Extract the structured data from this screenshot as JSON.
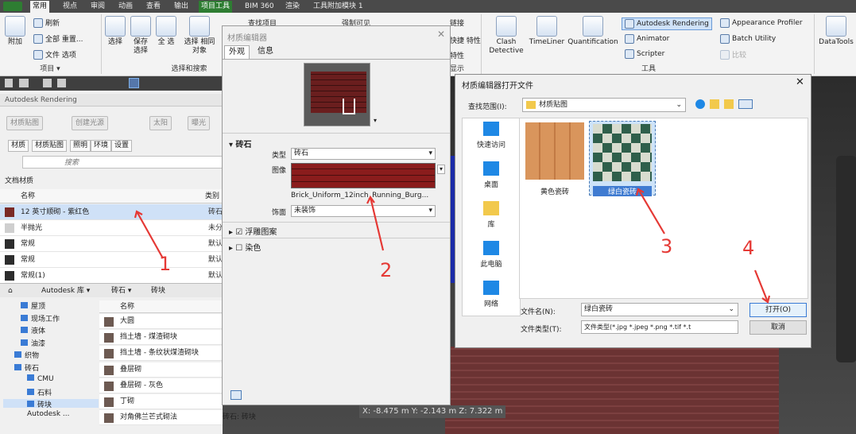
{
  "ribbon": {
    "tabs": [
      "常用",
      "视点",
      "审阅",
      "动画",
      "查看",
      "输出",
      "项目工具",
      "BIM 360",
      "渲染",
      "工具附加模块 1"
    ],
    "active_tab": "常用",
    "project_tab": "项目工具",
    "append": "附加",
    "refresh": "刷新",
    "reset_all": "全部 重置...",
    "file_options": "文件 选项",
    "select": "选择",
    "save_sel": "保存 选择",
    "select_all": "全 选",
    "select_same": "选择 相同对象",
    "group_project": "项目 ▾",
    "group_select": "选择和搜索",
    "find_items": "查找项目",
    "force_visible": "强制可见",
    "link": "链接",
    "quick_props": "快捷 特性",
    "props": "特性",
    "display": "显示",
    "clash": "Clash Detective",
    "timeliner": "TimeLiner",
    "quantification": "Quantification",
    "autodesk_rendering": "Autodesk Rendering",
    "appearance_profiler": "Appearance Profiler",
    "animator": "Animator",
    "batch_utility": "Batch Utility",
    "scripter": "Scripter",
    "compare": "比较",
    "group_tools": "工具",
    "datatools": "DataTools"
  },
  "rendering_panel": {
    "title": "Autodesk Rendering",
    "toolbar": [
      "材质贴图",
      "创建光源",
      "太阳",
      "曝光"
    ],
    "tabs": [
      "材质",
      "材质贴图",
      "照明",
      "环境",
      "设置"
    ],
    "search_placeholder": "搜索",
    "breadcrumb": "文档材质",
    "col_name": "名称",
    "col_type": "类别",
    "materials": [
      {
        "name": "12 英寸顺砌 - 紫红色",
        "type": "砖石",
        "swatch": "#7a2a26",
        "selected": true
      },
      {
        "name": "半抛光",
        "type": "未分",
        "swatch": "#cfcfcf"
      },
      {
        "name": "常规",
        "type": "默认",
        "swatch": "#2d2d2d"
      },
      {
        "name": "常规",
        "type": "默认",
        "swatch": "#2d2d2d"
      },
      {
        "name": "常规(1)",
        "type": "默认",
        "swatch": "#2d2d2d"
      }
    ],
    "lib_breadcrumb": [
      "Autodesk 库 ▾",
      "砖石 ▾",
      "砖块"
    ],
    "tree": [
      "屋顶",
      "现场工作",
      "液体",
      "油漆",
      "织物",
      "砖石",
      "CMU",
      "石料",
      "砖块"
    ],
    "lib_footer": "Autodesk ...",
    "lib_col_name": "名称",
    "lib_items": [
      {
        "name": "大圆",
        "type": ""
      },
      {
        "name": "挡土墙 - 煤渣砌块",
        "type": ""
      },
      {
        "name": "挡土墙 - 条纹状煤渣砌块",
        "type": ""
      },
      {
        "name": "叠层砌",
        "type": ""
      },
      {
        "name": "叠层砌 - 灰色",
        "type": ""
      },
      {
        "name": "丁砌",
        "type": ""
      },
      {
        "name": "对角佛兰芒式砌法",
        "type": "砖石: 砖块"
      }
    ]
  },
  "material_editor": {
    "title": "材质编辑器",
    "tabs": [
      "外观",
      "信息"
    ],
    "section": "砖石",
    "type_label": "类型",
    "type_value": "砖石",
    "image_label": "图像",
    "image_file": "Brick_Uniform_12inch_Running_Burg...",
    "finish_label": "饰面",
    "finish_value": "未装饰",
    "relief": "浮雕图案",
    "tint": "染色"
  },
  "open_dialog": {
    "title": "材质编辑器打开文件",
    "lookin_label": "查找范围(I):",
    "lookin_value": "材质贴图",
    "places": [
      "快速访问",
      "桌面",
      "库",
      "此电脑",
      "网络"
    ],
    "files": [
      {
        "name": "黄色瓷砖",
        "selected": false
      },
      {
        "name": "绿白瓷砖",
        "selected": true
      }
    ],
    "filename_label": "文件名(N):",
    "filename_value": "绿白瓷砖",
    "filetype_label": "文件类型(T):",
    "filetype_value": "文件类型(*.jpg *.jpeg *.png *.tif *.t",
    "open": "打开(O)",
    "cancel": "取消"
  },
  "viewport": {
    "coords": "X: -8.475 m  Y: -2.143 m  Z: 7.322 m"
  },
  "annotations": [
    "1",
    "2",
    "3",
    "4"
  ]
}
